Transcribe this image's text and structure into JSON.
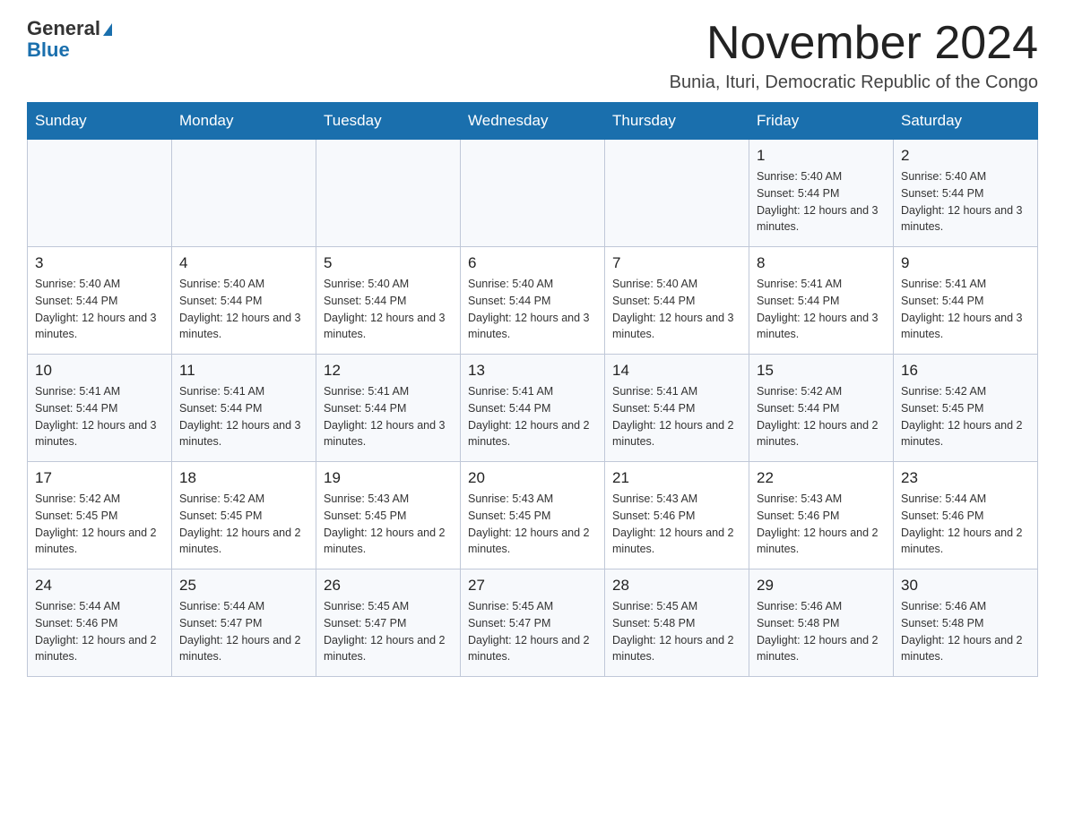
{
  "header": {
    "logo_general": "General",
    "logo_blue": "Blue",
    "month_title": "November 2024",
    "location": "Bunia, Ituri, Democratic Republic of the Congo"
  },
  "weekdays": [
    "Sunday",
    "Monday",
    "Tuesday",
    "Wednesday",
    "Thursday",
    "Friday",
    "Saturday"
  ],
  "weeks": [
    [
      {
        "day": "",
        "sunrise": "",
        "sunset": "",
        "daylight": ""
      },
      {
        "day": "",
        "sunrise": "",
        "sunset": "",
        "daylight": ""
      },
      {
        "day": "",
        "sunrise": "",
        "sunset": "",
        "daylight": ""
      },
      {
        "day": "",
        "sunrise": "",
        "sunset": "",
        "daylight": ""
      },
      {
        "day": "",
        "sunrise": "",
        "sunset": "",
        "daylight": ""
      },
      {
        "day": "1",
        "sunrise": "Sunrise: 5:40 AM",
        "sunset": "Sunset: 5:44 PM",
        "daylight": "Daylight: 12 hours and 3 minutes."
      },
      {
        "day": "2",
        "sunrise": "Sunrise: 5:40 AM",
        "sunset": "Sunset: 5:44 PM",
        "daylight": "Daylight: 12 hours and 3 minutes."
      }
    ],
    [
      {
        "day": "3",
        "sunrise": "Sunrise: 5:40 AM",
        "sunset": "Sunset: 5:44 PM",
        "daylight": "Daylight: 12 hours and 3 minutes."
      },
      {
        "day": "4",
        "sunrise": "Sunrise: 5:40 AM",
        "sunset": "Sunset: 5:44 PM",
        "daylight": "Daylight: 12 hours and 3 minutes."
      },
      {
        "day": "5",
        "sunrise": "Sunrise: 5:40 AM",
        "sunset": "Sunset: 5:44 PM",
        "daylight": "Daylight: 12 hours and 3 minutes."
      },
      {
        "day": "6",
        "sunrise": "Sunrise: 5:40 AM",
        "sunset": "Sunset: 5:44 PM",
        "daylight": "Daylight: 12 hours and 3 minutes."
      },
      {
        "day": "7",
        "sunrise": "Sunrise: 5:40 AM",
        "sunset": "Sunset: 5:44 PM",
        "daylight": "Daylight: 12 hours and 3 minutes."
      },
      {
        "day": "8",
        "sunrise": "Sunrise: 5:41 AM",
        "sunset": "Sunset: 5:44 PM",
        "daylight": "Daylight: 12 hours and 3 minutes."
      },
      {
        "day": "9",
        "sunrise": "Sunrise: 5:41 AM",
        "sunset": "Sunset: 5:44 PM",
        "daylight": "Daylight: 12 hours and 3 minutes."
      }
    ],
    [
      {
        "day": "10",
        "sunrise": "Sunrise: 5:41 AM",
        "sunset": "Sunset: 5:44 PM",
        "daylight": "Daylight: 12 hours and 3 minutes."
      },
      {
        "day": "11",
        "sunrise": "Sunrise: 5:41 AM",
        "sunset": "Sunset: 5:44 PM",
        "daylight": "Daylight: 12 hours and 3 minutes."
      },
      {
        "day": "12",
        "sunrise": "Sunrise: 5:41 AM",
        "sunset": "Sunset: 5:44 PM",
        "daylight": "Daylight: 12 hours and 3 minutes."
      },
      {
        "day": "13",
        "sunrise": "Sunrise: 5:41 AM",
        "sunset": "Sunset: 5:44 PM",
        "daylight": "Daylight: 12 hours and 2 minutes."
      },
      {
        "day": "14",
        "sunrise": "Sunrise: 5:41 AM",
        "sunset": "Sunset: 5:44 PM",
        "daylight": "Daylight: 12 hours and 2 minutes."
      },
      {
        "day": "15",
        "sunrise": "Sunrise: 5:42 AM",
        "sunset": "Sunset: 5:44 PM",
        "daylight": "Daylight: 12 hours and 2 minutes."
      },
      {
        "day": "16",
        "sunrise": "Sunrise: 5:42 AM",
        "sunset": "Sunset: 5:45 PM",
        "daylight": "Daylight: 12 hours and 2 minutes."
      }
    ],
    [
      {
        "day": "17",
        "sunrise": "Sunrise: 5:42 AM",
        "sunset": "Sunset: 5:45 PM",
        "daylight": "Daylight: 12 hours and 2 minutes."
      },
      {
        "day": "18",
        "sunrise": "Sunrise: 5:42 AM",
        "sunset": "Sunset: 5:45 PM",
        "daylight": "Daylight: 12 hours and 2 minutes."
      },
      {
        "day": "19",
        "sunrise": "Sunrise: 5:43 AM",
        "sunset": "Sunset: 5:45 PM",
        "daylight": "Daylight: 12 hours and 2 minutes."
      },
      {
        "day": "20",
        "sunrise": "Sunrise: 5:43 AM",
        "sunset": "Sunset: 5:45 PM",
        "daylight": "Daylight: 12 hours and 2 minutes."
      },
      {
        "day": "21",
        "sunrise": "Sunrise: 5:43 AM",
        "sunset": "Sunset: 5:46 PM",
        "daylight": "Daylight: 12 hours and 2 minutes."
      },
      {
        "day": "22",
        "sunrise": "Sunrise: 5:43 AM",
        "sunset": "Sunset: 5:46 PM",
        "daylight": "Daylight: 12 hours and 2 minutes."
      },
      {
        "day": "23",
        "sunrise": "Sunrise: 5:44 AM",
        "sunset": "Sunset: 5:46 PM",
        "daylight": "Daylight: 12 hours and 2 minutes."
      }
    ],
    [
      {
        "day": "24",
        "sunrise": "Sunrise: 5:44 AM",
        "sunset": "Sunset: 5:46 PM",
        "daylight": "Daylight: 12 hours and 2 minutes."
      },
      {
        "day": "25",
        "sunrise": "Sunrise: 5:44 AM",
        "sunset": "Sunset: 5:47 PM",
        "daylight": "Daylight: 12 hours and 2 minutes."
      },
      {
        "day": "26",
        "sunrise": "Sunrise: 5:45 AM",
        "sunset": "Sunset: 5:47 PM",
        "daylight": "Daylight: 12 hours and 2 minutes."
      },
      {
        "day": "27",
        "sunrise": "Sunrise: 5:45 AM",
        "sunset": "Sunset: 5:47 PM",
        "daylight": "Daylight: 12 hours and 2 minutes."
      },
      {
        "day": "28",
        "sunrise": "Sunrise: 5:45 AM",
        "sunset": "Sunset: 5:48 PM",
        "daylight": "Daylight: 12 hours and 2 minutes."
      },
      {
        "day": "29",
        "sunrise": "Sunrise: 5:46 AM",
        "sunset": "Sunset: 5:48 PM",
        "daylight": "Daylight: 12 hours and 2 minutes."
      },
      {
        "day": "30",
        "sunrise": "Sunrise: 5:46 AM",
        "sunset": "Sunset: 5:48 PM",
        "daylight": "Daylight: 12 hours and 2 minutes."
      }
    ]
  ]
}
